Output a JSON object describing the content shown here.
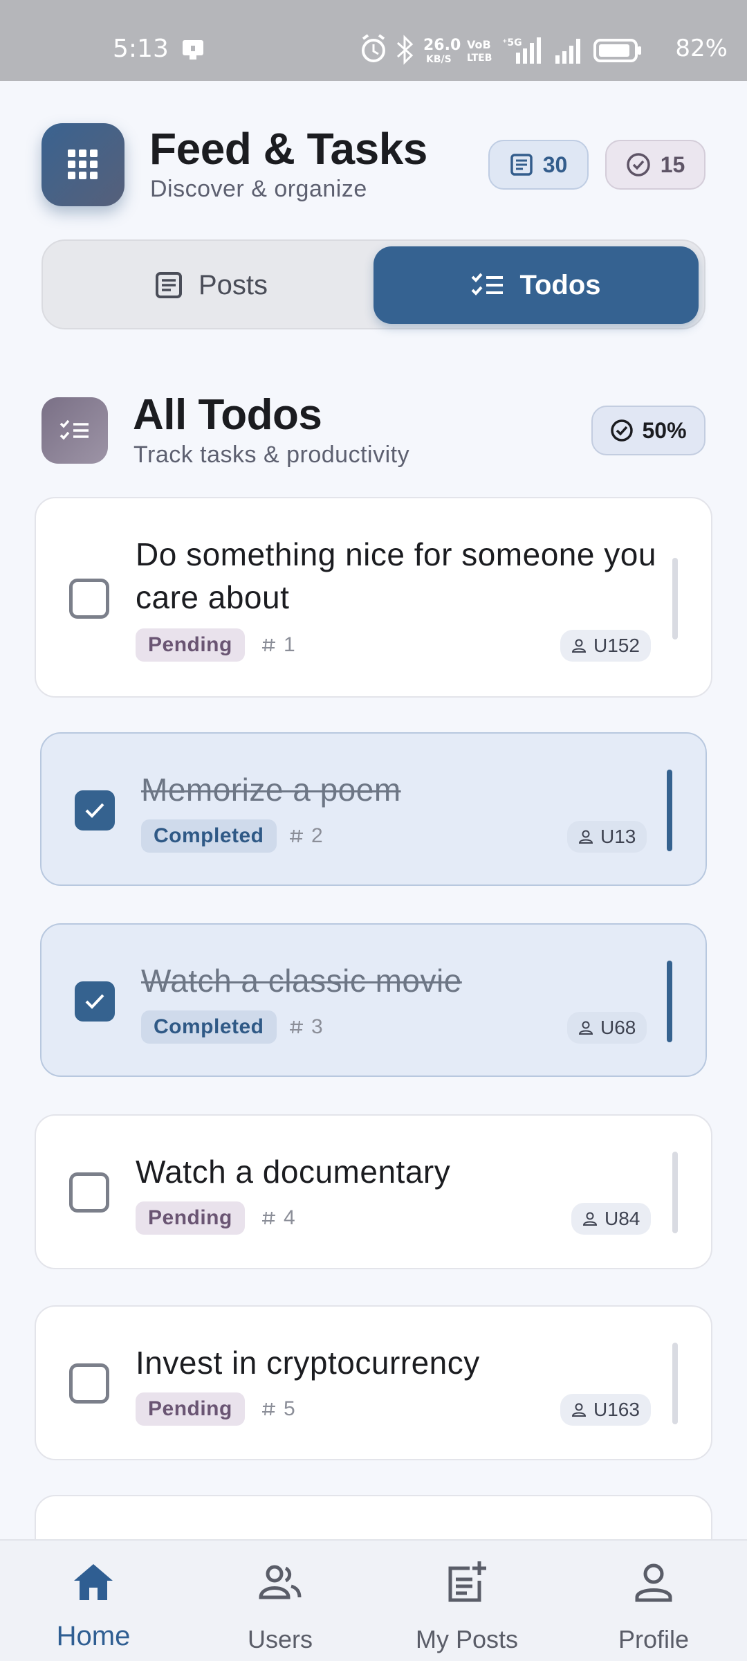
{
  "status_bar": {
    "time": "5:13",
    "net_speed_value": "26.0",
    "net_speed_unit": "KB/S",
    "volte": "VoB LTEB",
    "network": "5G",
    "battery_percent": "82%",
    "icons": [
      "alarm-icon",
      "bluetooth-icon",
      "signal-icon",
      "battery-icon"
    ]
  },
  "header": {
    "title": "Feed & Tasks",
    "subtitle": "Discover & organize",
    "posts_count": "30",
    "todos_count": "15"
  },
  "tabs": [
    {
      "label": "Posts",
      "icon": "article-icon",
      "active": false
    },
    {
      "label": "Todos",
      "icon": "checklist-icon",
      "active": true
    }
  ],
  "section": {
    "title": "All Todos",
    "subtitle": "Track tasks & productivity",
    "completion_percent": "50%"
  },
  "todos": [
    {
      "text": "Do something nice for someone you care about",
      "status": "Pending",
      "number": "1",
      "user": "U152",
      "completed": false
    },
    {
      "text": "Memorize a poem",
      "status": "Completed",
      "number": "2",
      "user": "U13",
      "completed": true
    },
    {
      "text": "Watch a classic movie",
      "status": "Completed",
      "number": "3",
      "user": "U68",
      "completed": true
    },
    {
      "text": "Watch a documentary",
      "status": "Pending",
      "number": "4",
      "user": "U84",
      "completed": false
    },
    {
      "text": "Invest in cryptocurrency",
      "status": "Pending",
      "number": "5",
      "user": "U163",
      "completed": false
    }
  ],
  "bottom_nav": [
    {
      "label": "Home",
      "icon": "home-icon",
      "active": true
    },
    {
      "label": "Users",
      "icon": "users-icon",
      "active": false
    },
    {
      "label": "My Posts",
      "icon": "post-add-icon",
      "active": false
    },
    {
      "label": "Profile",
      "icon": "profile-icon",
      "active": false
    }
  ],
  "colors": {
    "primary": "#356291",
    "background": "#f5f7fc",
    "completed_card": "#e4ebf7",
    "pending_badge": "#e9e2ec"
  }
}
